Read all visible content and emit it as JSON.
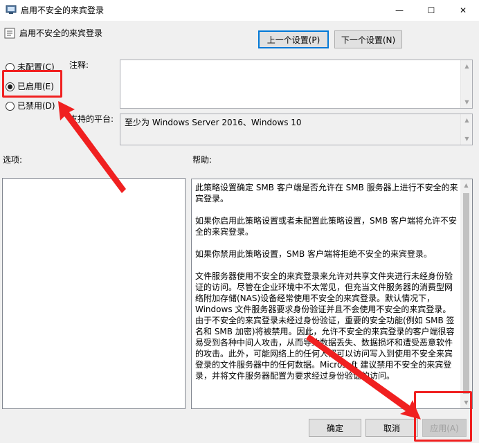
{
  "window": {
    "title": "启用不安全的来宾登录",
    "minimize_icon": "—",
    "maximize_icon": "☐",
    "close_icon": "✕"
  },
  "header": {
    "policy_title": "启用不安全的来宾登录",
    "prev_button": "上一个设置(P)",
    "next_button": "下一个设置(N)"
  },
  "state": {
    "options": [
      {
        "label": "未配置(C)",
        "selected": false
      },
      {
        "label": "已启用(E)",
        "selected": true
      },
      {
        "label": "已禁用(D)",
        "selected": false
      }
    ]
  },
  "comment": {
    "label": "注释:",
    "value": ""
  },
  "platform": {
    "label": "支持的平台:",
    "value": "至少为 Windows Server 2016、Windows 10"
  },
  "options_pane": {
    "label": "选项:"
  },
  "help_pane": {
    "label": "帮助:",
    "paragraphs": [
      "此策略设置确定 SMB 客户端是否允许在 SMB 服务器上进行不安全的来宾登录。",
      "如果你启用此策略设置或者未配置此策略设置，SMB 客户端将允许不安全的来宾登录。",
      "如果你禁用此策略设置，SMB 客户端将拒绝不安全的来宾登录。",
      "文件服务器使用不安全的来宾登录来允许对共享文件夹进行未经身份验证的访问。尽管在企业环境中不太常见，但充当文件服务器的消费型网络附加存储(NAS)设备经常使用不安全的来宾登录。默认情况下，Windows 文件服务器要求身份验证并且不会使用不安全的来宾登录。由于不安全的来宾登录未经过身份验证，重要的安全功能(例如 SMB 签名和 SMB 加密)将被禁用。因此，允许不安全的来宾登录的客户端很容易受到各种中间人攻击，从而导致数据丢失、数据损坏和遭受恶意软件的攻击。此外，可能网络上的任何人都可以访问写入到使用不安全来宾登录的文件服务器中的任何数据。Microsoft 建议禁用不安全的来宾登录，并将文件服务器配置为要求经过身份验证的访问。"
    ]
  },
  "footer": {
    "ok_button": "确定",
    "cancel_button": "取消",
    "apply_button": "应用(A)"
  },
  "colors": {
    "annotation": "#f02020",
    "focus_border": "#0078d7"
  }
}
